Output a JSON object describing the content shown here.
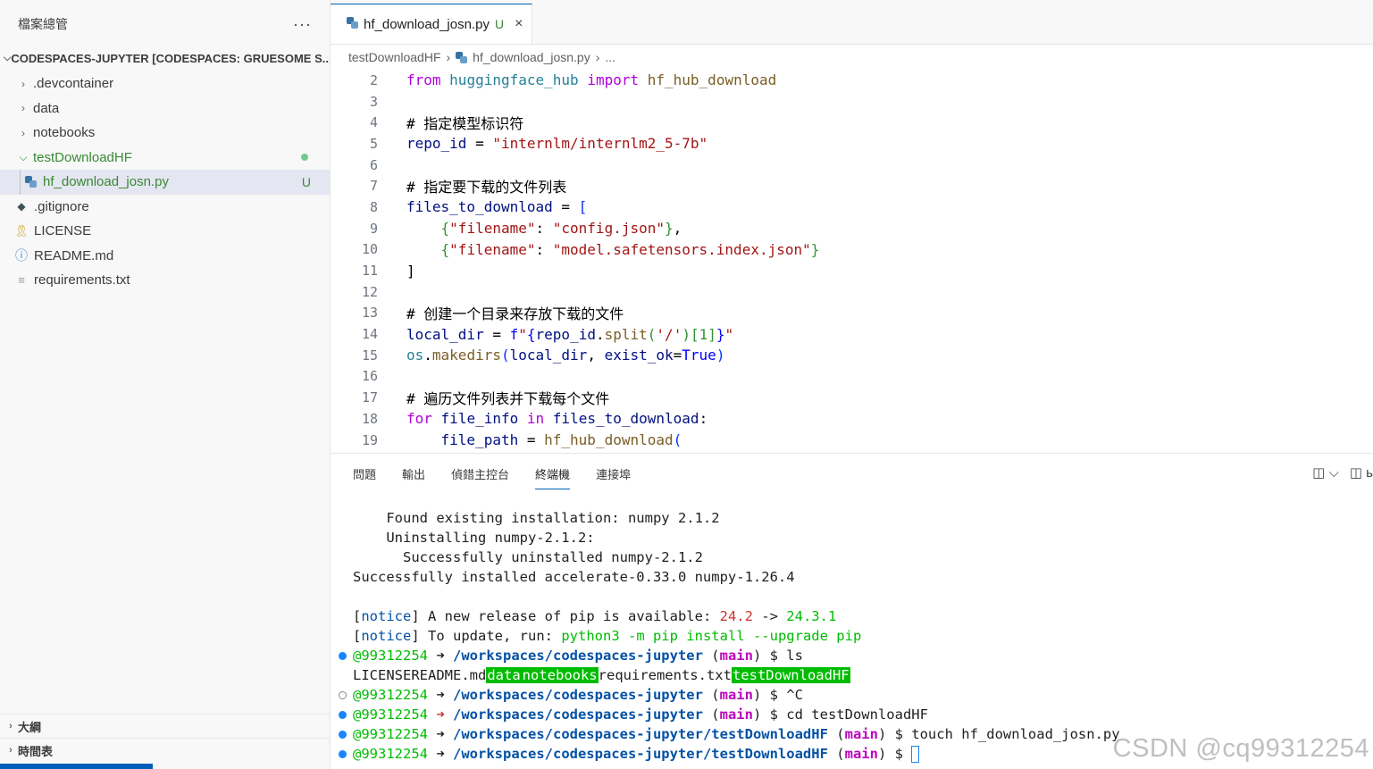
{
  "sidebar": {
    "title": "檔案總管",
    "more": "···",
    "workspace": "CODESPACES-JUPYTER [CODESPACES: GRUESOME S...",
    "items": [
      {
        "label": ".devcontainer"
      },
      {
        "label": "data"
      },
      {
        "label": "notebooks"
      },
      {
        "label": "testDownloadHF"
      },
      {
        "label": "hf_download_josn.py",
        "badge": "U"
      },
      {
        "label": ".gitignore"
      },
      {
        "label": "LICENSE"
      },
      {
        "label": "README.md"
      },
      {
        "label": "requirements.txt"
      }
    ],
    "outline": "大綱",
    "timeline": "時間表"
  },
  "editor": {
    "tab": {
      "label": "hf_download_josn.py",
      "badge": "U",
      "close": "×"
    },
    "breadcrumb": {
      "folder": "testDownloadHF",
      "file": "hf_download_josn.py",
      "more": "..."
    },
    "line_numbers": [
      "2",
      "3",
      "4",
      "5",
      "6",
      "7",
      "8",
      "9",
      "10",
      "11",
      "12",
      "13",
      "14",
      "15",
      "16",
      "17",
      "18",
      "19"
    ],
    "code": {
      "l2_from": "from",
      "l2_mod": "huggingface_hub",
      "l2_import": "import",
      "l2_name": "hf_hub_download",
      "l4": "# 指定模型标识符",
      "l5_var": "repo_id",
      "l5_eq": " = ",
      "l5_str": "\"internlm/internlm2_5-7b\"",
      "l7": "# 指定要下载的文件列表",
      "l8_var": "files_to_download",
      "l8_eq": " = ",
      "l8_br": "[",
      "l9_open": "{",
      "l9_key": "\"filename\"",
      "l9_colon": ": ",
      "l9_val": "\"config.json\"",
      "l9_close": "}",
      "l9_comma": ",",
      "l10_open": "{",
      "l10_key": "\"filename\"",
      "l10_colon": ": ",
      "l10_val": "\"model.safetensors.index.json\"",
      "l10_close": "}",
      "l11": "]",
      "l13": "# 创建一个目录来存放下载的文件",
      "l14_var": "local_dir",
      "l14_eq": " = ",
      "l14_f": "f",
      "l14_q1": "\"",
      "l14_ob": "{",
      "l14_repo": "repo_id",
      "l14_dot": ".",
      "l14_split": "split",
      "l14_po": "(",
      "l14_arg": "'/'",
      "l14_pc": ")",
      "l14_idx": "[1]",
      "l14_cb": "}",
      "l14_q2": "\"",
      "l15_os": "os",
      "l15_dot": ".",
      "l15_fn": "makedirs",
      "l15_po": "(",
      "l15_a1": "local_dir",
      "l15_comma": ", ",
      "l15_a2": "exist_ok",
      "l15_eq": "=",
      "l15_true": "True",
      "l15_pc": ")",
      "l17": "# 遍历文件列表并下载每个文件",
      "l18_for": "for",
      "l18_var": "file_info",
      "l18_in": "in",
      "l18_iter": "files_to_download",
      "l18_colon": ":",
      "l19_var": "file_path",
      "l19_eq": " = ",
      "l19_fn": "hf_hub_download",
      "l19_po": "("
    }
  },
  "panel": {
    "tabs": [
      "問題",
      "輸出",
      "偵錯主控台",
      "終端機",
      "連接埠"
    ],
    "active_tab": "終端機",
    "terminal": {
      "l1": "    Found existing installation: numpy 2.1.2",
      "l2": "    Uninstalling numpy-2.1.2:",
      "l3": "      Successfully uninstalled numpy-2.1.2",
      "l4": "Successfully installed accelerate-0.33.0 numpy-1.26.4",
      "notice1_tag": "notice",
      "notice1_text": " A new release of pip is available: ",
      "notice1_old": "24.2",
      "notice1_arrow": " -> ",
      "notice1_new": "24.3.1",
      "notice2_tag": "notice",
      "notice2_text": " To update, run: ",
      "notice2_cmd": "python3 -m pip install --upgrade pip",
      "user": "@99312254",
      "arrow": " ➜ ",
      "path": "/workspaces/codespaces-jupyter",
      "path2": "/workspaces/codespaces-jupyter/testDownloadHF",
      "branch": "main",
      "cmd_ls": "$ ls",
      "ls_license": "LICENSE",
      "ls_readme": "README.md",
      "ls_data": "data",
      "ls_notebooks": "notebooks",
      "ls_req": "requirements.txt",
      "ls_test": "testDownloadHF",
      "cmd_ctrlc": "$ ^C",
      "cmd_cd": "$ cd testDownloadHF",
      "cmd_touch": "$ touch hf_download_josn.py",
      "cmd_prompt": "$ "
    }
  },
  "watermark": "CSDN @cq99312254",
  "colors": {
    "accent": "#005fb8",
    "git_untracked": "#388a34",
    "terminal_green": "#00bc00",
    "terminal_blue": "#0451a5"
  }
}
